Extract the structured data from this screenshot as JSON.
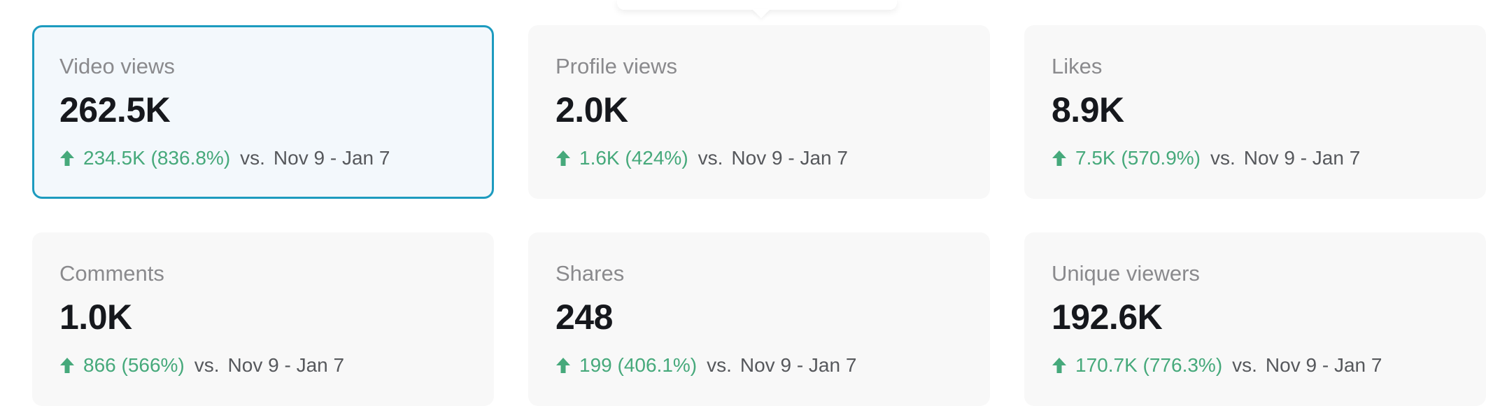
{
  "accent_color": "#1d9bbf",
  "positive_color": "#46a97b",
  "metrics": [
    {
      "label": "Video views",
      "value": "262.5K",
      "delta": "234.5K (836.8%)",
      "vs": "vs.",
      "range": "Nov 9 - Jan 7",
      "trend_icon": "arrow-up-icon",
      "selected": true
    },
    {
      "label": "Profile views",
      "value": "2.0K",
      "delta": "1.6K (424%)",
      "vs": "vs.",
      "range": "Nov 9 - Jan 7",
      "trend_icon": "arrow-up-icon",
      "selected": false
    },
    {
      "label": "Likes",
      "value": "8.9K",
      "delta": "7.5K (570.9%)",
      "vs": "vs.",
      "range": "Nov 9 - Jan 7",
      "trend_icon": "arrow-up-icon",
      "selected": false
    },
    {
      "label": "Comments",
      "value": "1.0K",
      "delta": "866 (566%)",
      "vs": "vs.",
      "range": "Nov 9 - Jan 7",
      "trend_icon": "arrow-up-icon",
      "selected": false
    },
    {
      "label": "Shares",
      "value": "248",
      "delta": "199 (406.1%)",
      "vs": "vs.",
      "range": "Nov 9 - Jan 7",
      "trend_icon": "arrow-up-icon",
      "selected": false
    },
    {
      "label": "Unique viewers",
      "value": "192.6K",
      "delta": "170.7K (776.3%)",
      "vs": "vs.",
      "range": "Nov 9 - Jan 7",
      "trend_icon": "arrow-up-icon",
      "selected": false
    }
  ]
}
